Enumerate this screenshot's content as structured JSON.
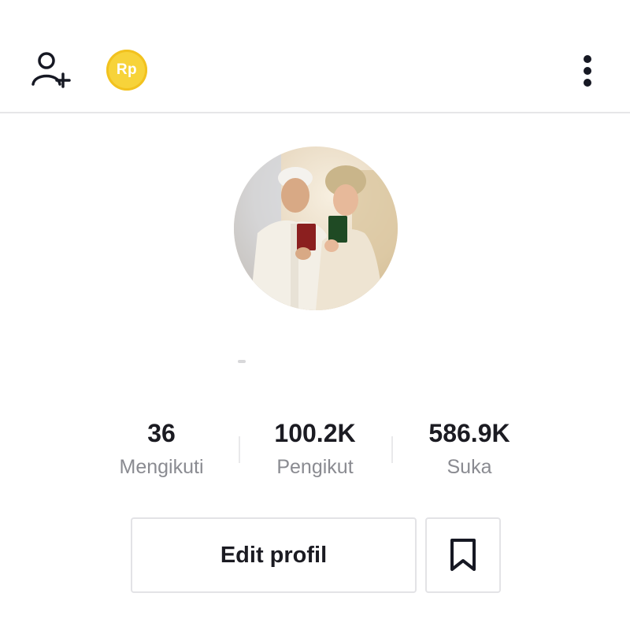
{
  "header": {
    "coin_label": "Rp",
    "icons": [
      "add-friend-icon",
      "coin-icon",
      "more-icon"
    ]
  },
  "profile": {
    "avatar": "profile-photo"
  },
  "stats": {
    "following": {
      "value": "36",
      "label": "Mengikuti"
    },
    "followers": {
      "value": "100.2K",
      "label": "Pengikut"
    },
    "likes": {
      "value": "586.9K",
      "label": "Suka"
    }
  },
  "actions": {
    "edit_label": "Edit profil",
    "bookmark_icon": "bookmark-icon"
  },
  "colors": {
    "coin": "#f7d33a",
    "text_primary": "#161823",
    "text_secondary": "#8a8b91",
    "border": "#e3e3e6"
  }
}
